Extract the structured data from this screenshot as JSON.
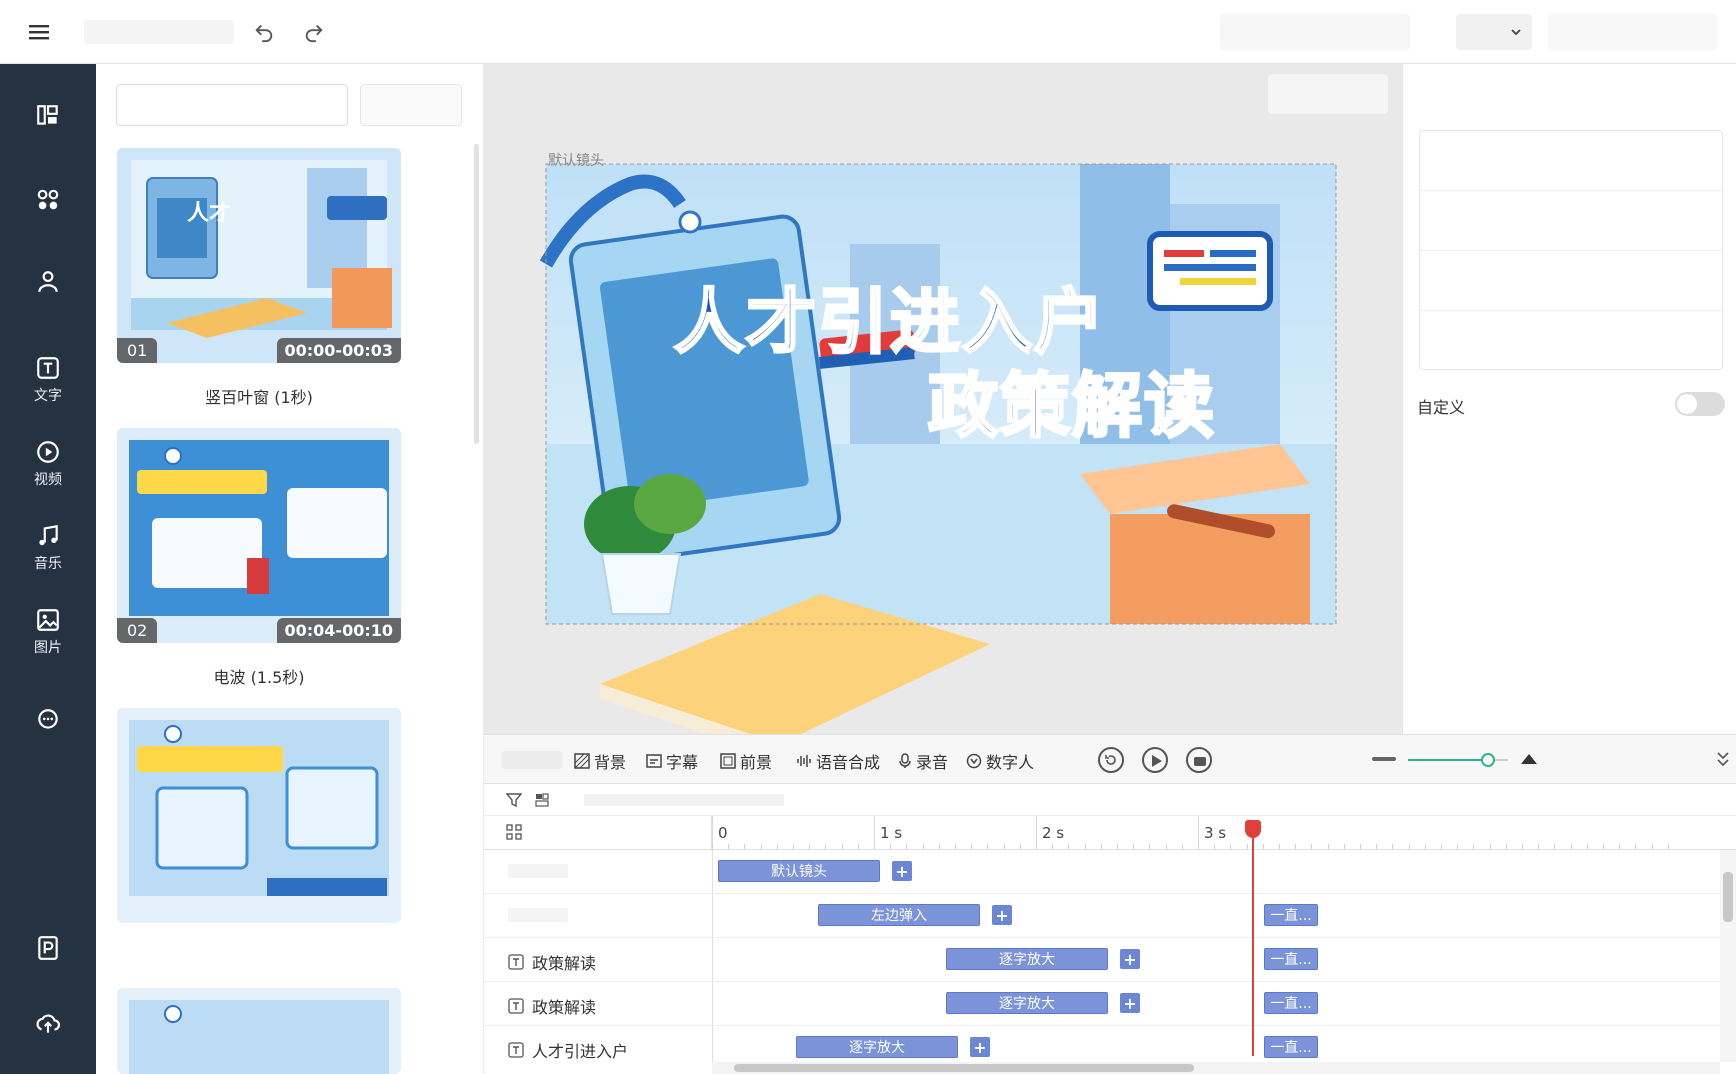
{
  "header": {
    "menu_icon": "hamburger-icon",
    "undo_icon": "undo-icon",
    "redo_icon": "redo-icon"
  },
  "sidebar": {
    "items": [
      {
        "icon": "layout-icon",
        "label": ""
      },
      {
        "icon": "grid-icon",
        "label": ""
      },
      {
        "icon": "person-icon",
        "label": ""
      },
      {
        "icon": "text-icon",
        "label": "文字"
      },
      {
        "icon": "video-icon",
        "label": "视频"
      },
      {
        "icon": "music-icon",
        "label": "音乐"
      },
      {
        "icon": "image-icon",
        "label": "图片"
      },
      {
        "icon": "chat-icon",
        "label": ""
      },
      {
        "icon": "ppt-icon",
        "label": ""
      },
      {
        "icon": "upload-icon",
        "label": ""
      }
    ]
  },
  "templates": [
    {
      "num": "01",
      "time": "00:00-00:03",
      "label": "竖百叶窗 (1秒)"
    },
    {
      "num": "02",
      "time": "00:04-00:10",
      "label": "电波 (1.5秒)"
    },
    {
      "num": "",
      "time": "",
      "label": ""
    }
  ],
  "preview": {
    "scene_label": "默认镜头",
    "title_line1": "人才引进入户",
    "title_line2": "政策解读"
  },
  "properties": {
    "custom_label": "自定义",
    "custom_toggle": false
  },
  "toolbar": {
    "background": "背景",
    "subtitle": "字幕",
    "foreground": "前景",
    "tts": "语音合成",
    "record": "录音",
    "digital_human": "数字人",
    "zoom_level": 0.8
  },
  "timeline": {
    "ticks": [
      "0",
      "1 s",
      "2 s",
      "3 s"
    ],
    "playhead_seconds": 3.3,
    "tracks": [
      {
        "label": "",
        "clip": "默认镜头",
        "tail": ""
      },
      {
        "label": "",
        "clip": "左边弹入",
        "tail": "一直..."
      },
      {
        "label": "政策解读",
        "clip": "逐字放大",
        "tail": "一直..."
      },
      {
        "label": "政策解读",
        "clip": "逐字放大",
        "tail": "一直..."
      },
      {
        "label": "人才引进入户",
        "clip": "逐字放大",
        "tail": "一直..."
      }
    ]
  },
  "colors": {
    "rail": "#243241",
    "clip": "#7b93d8",
    "playhead": "#e0403a",
    "slider": "#2bb38a"
  }
}
